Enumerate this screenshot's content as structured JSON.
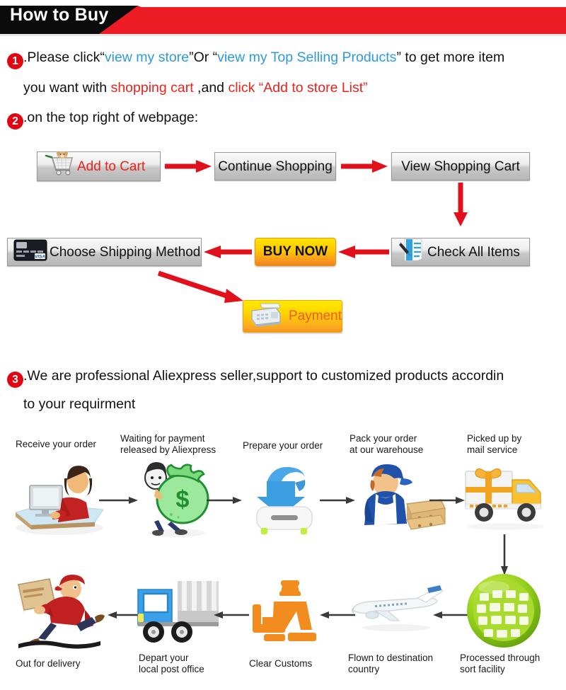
{
  "header": {
    "title": "How to Buy",
    "bar_color": "#ed1c24",
    "title_bg": "#0b0b0b"
  },
  "steps": {
    "one": {
      "number": "1",
      "line1_a": ".Please click",
      "line1_quote_open": "“",
      "line1_link1": "view my store",
      "line1_quote_close": "”",
      "line1_b": "Or ",
      "line1_quote_open2": "“",
      "line1_link2": "view my Top Selling Products",
      "line1_quote_close2": "”",
      "line1_c": " to get more item",
      "line2_a": "you want with ",
      "line2_red1": "shopping cart",
      "line2_b": " ,and ",
      "line2_red2": "click “Add to store List”"
    },
    "two": {
      "number": "2",
      "text": ".on the top right of webpage:"
    },
    "three": {
      "number": "3",
      "line1": ".We are professional Aliexpress seller,support to customized products accordin",
      "line2": "to your requirment"
    }
  },
  "buy_flow": {
    "add_to_cart": {
      "label": "Add to Cart",
      "icon": "shopping-cart-icon",
      "text_color": "#e8231b"
    },
    "continue_shopping": {
      "label": "Continue Shopping"
    },
    "view_shopping_cart": {
      "label": "View Shopping Cart"
    },
    "check_all_items": {
      "label": "Check All Items",
      "icon": "checklist-icon"
    },
    "buy_now": {
      "label": "BUY NOW"
    },
    "choose_shipping": {
      "label": "Choose Shipping Method",
      "icon": "credit-card-icon"
    },
    "payment": {
      "label": "Payment",
      "icon": "pos-terminal-icon"
    },
    "arrow_color": "#e2101a"
  },
  "shipping_flow": {
    "row1": [
      {
        "label_line1": "Receive your order",
        "label_line2": "",
        "icon": "person-at-computer-icon"
      },
      {
        "label_line1": "Waiting for payment",
        "label_line2": "released by Aliexpress",
        "icon": "money-bag-icon"
      },
      {
        "label_line1": "Prepare your order",
        "label_line2": "",
        "icon": "download-arrow-icon"
      },
      {
        "label_line1": "Pack your order",
        "label_line2": "at our warehouse",
        "icon": "warehouse-worker-icon"
      },
      {
        "label_line1": "Picked up by",
        "label_line2": "mail service",
        "icon": "gift-truck-icon"
      }
    ],
    "row2": [
      {
        "label_line1": "Out for delivery",
        "label_line2": "",
        "icon": "running-courier-icon"
      },
      {
        "label_line1": "Depart your",
        "label_line2": "local post office",
        "icon": "blue-truck-icon"
      },
      {
        "label_line1": "Clear Customs",
        "label_line2": "",
        "icon": "customs-officer-icon"
      },
      {
        "label_line1": "Flown to destination",
        "label_line2": "country",
        "icon": "airplane-icon"
      },
      {
        "label_line1": "Processed through",
        "label_line2": "sort facility",
        "icon": "green-globe-icon"
      }
    ],
    "arrow_color": "#3a3a3a"
  }
}
